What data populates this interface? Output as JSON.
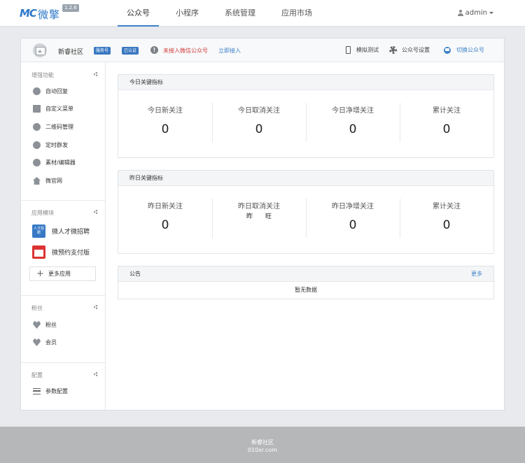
{
  "brand": {
    "logo_mark": "MC",
    "logo_text": "微擎",
    "version": "1.2.6"
  },
  "nav": {
    "tabs": [
      {
        "label": "公众号",
        "active": true
      },
      {
        "label": "小程序",
        "active": false
      },
      {
        "label": "系统管理",
        "active": false
      },
      {
        "label": "应用市场",
        "active": false
      }
    ],
    "user": "admin"
  },
  "account": {
    "name": "新睿社区",
    "badge_type": "服务号",
    "badge_verified": "已认证",
    "warning": "未接入微信公众号",
    "connect_link": "立即接入",
    "actions": {
      "simulate": "模拟测试",
      "settings": "公众号设置",
      "switch": "切换公众号"
    }
  },
  "sidebar": {
    "sections": [
      {
        "title": "增强功能",
        "items": [
          {
            "label": "自动回复",
            "icon": "chat-icon"
          },
          {
            "label": "自定义菜单",
            "icon": "document-icon"
          },
          {
            "label": "二维码管理",
            "icon": "qrcode-icon"
          },
          {
            "label": "定时群发",
            "icon": "timer-icon"
          },
          {
            "label": "素材/编辑器",
            "icon": "edit-icon"
          },
          {
            "label": "微官网",
            "icon": "home-icon"
          }
        ]
      },
      {
        "title": "应用模块",
        "apps": [
          {
            "label": "微人才微招聘",
            "icon_text": "人才招聘"
          },
          {
            "label": "微预约支付版"
          }
        ],
        "more": "更多应用"
      },
      {
        "title": "粉丝",
        "items": [
          {
            "label": "粉丝",
            "icon": "heart-icon"
          },
          {
            "label": "会员",
            "icon": "heart-icon"
          }
        ]
      },
      {
        "title": "配置",
        "items": [
          {
            "label": "参数配置",
            "icon": "list-icon"
          }
        ]
      }
    ]
  },
  "today": {
    "title": "今日关键指标",
    "stats": [
      {
        "label": "今日新关注",
        "value": "0"
      },
      {
        "label": "今日取消关注",
        "value": "0"
      },
      {
        "label": "今日净增关注",
        "value": "0"
      },
      {
        "label": "累计关注",
        "value": "0"
      }
    ]
  },
  "yesterday": {
    "title": "昨日关键指标",
    "stats": [
      {
        "label": "昨日新关注",
        "value": "0"
      },
      {
        "label": "昨日取消关注",
        "value": ""
      },
      {
        "label": "昨日净增关注",
        "value": "0"
      },
      {
        "label": "累计关注",
        "value": "0"
      }
    ],
    "overlay_glitch": "昨　　旺"
  },
  "notice": {
    "title": "公告",
    "more": "更多",
    "empty": "暂无数据"
  },
  "footer": {
    "line1": "新睿社区",
    "line2": "010xr.com"
  }
}
